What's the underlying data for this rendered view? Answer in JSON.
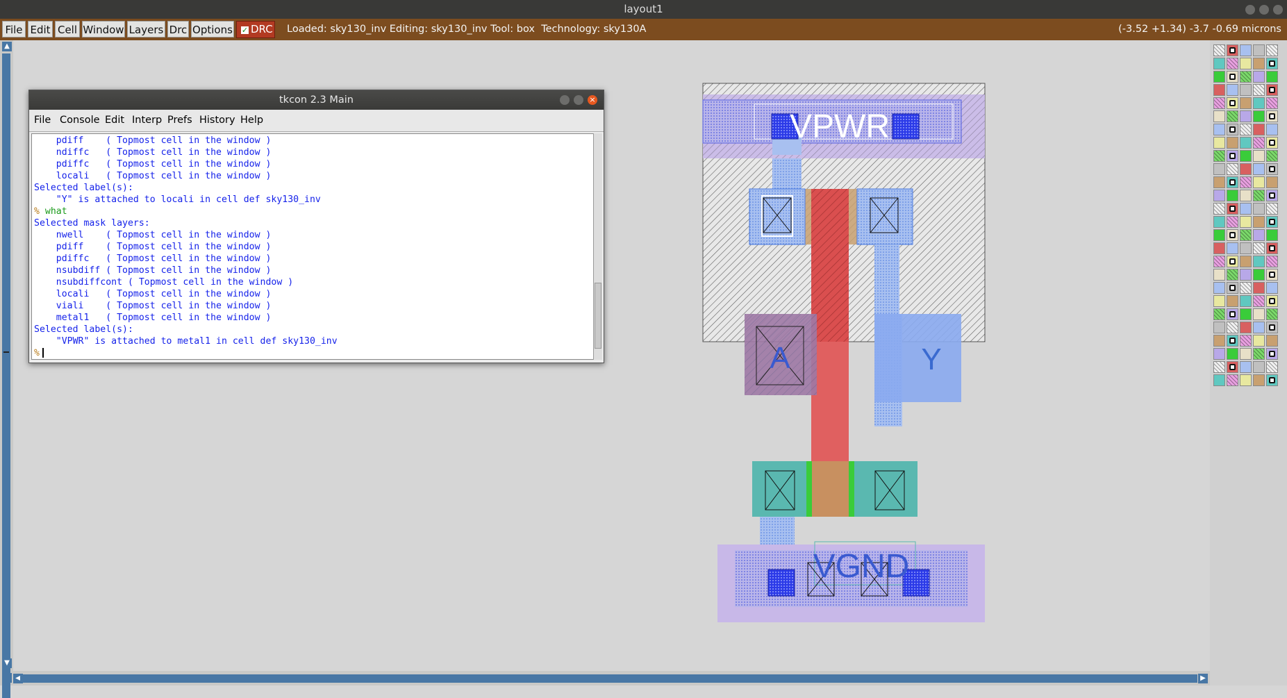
{
  "window": {
    "title": "layout1"
  },
  "menu": {
    "items": [
      "File",
      "Edit",
      "Cell",
      "Window",
      "Layers",
      "Drc",
      "Options"
    ],
    "drc_toggle": "DRC",
    "status": "Loaded: sky130_inv Editing: sky130_inv Tool: box  Technology: sky130A",
    "coords": "(-3.52 +1.34) -3.7 -0.69 microns"
  },
  "tkcon": {
    "title": "tkcon 2.3 Main",
    "menu": [
      "File",
      "Console",
      "Edit",
      "Interp",
      "Prefs",
      "History",
      "Help"
    ],
    "lines": [
      {
        "t": "    pdiff    ( Topmost cell in the window )",
        "c": "out"
      },
      {
        "t": "    ndiffc   ( Topmost cell in the window )",
        "c": "out"
      },
      {
        "t": "    pdiffc   ( Topmost cell in the window )",
        "c": "out"
      },
      {
        "t": "    locali   ( Topmost cell in the window )",
        "c": "out"
      },
      {
        "t": "Selected label(s):",
        "c": "out"
      },
      {
        "t": "    \"Y\" is attached to locali in cell def sky130_inv",
        "c": "out"
      },
      {
        "t": "what",
        "c": "cmd"
      },
      {
        "t": "Selected mask layers:",
        "c": "out"
      },
      {
        "t": "    nwell    ( Topmost cell in the window )",
        "c": "out"
      },
      {
        "t": "    pdiff    ( Topmost cell in the window )",
        "c": "out"
      },
      {
        "t": "    pdiffc   ( Topmost cell in the window )",
        "c": "out"
      },
      {
        "t": "    nsubdiff ( Topmost cell in the window )",
        "c": "out"
      },
      {
        "t": "    nsubdiffcont ( Topmost cell in the window )",
        "c": "out"
      },
      {
        "t": "    locali   ( Topmost cell in the window )",
        "c": "out"
      },
      {
        "t": "    viali    ( Topmost cell in the window )",
        "c": "out"
      },
      {
        "t": "    metal1   ( Topmost cell in the window )",
        "c": "out"
      },
      {
        "t": "Selected label(s):",
        "c": "out"
      },
      {
        "t": "    \"VPWR\" is attached to metal1 in cell def sky130_inv",
        "c": "out"
      },
      {
        "t": "",
        "c": "prompt"
      }
    ],
    "prompt": "%"
  },
  "layout_labels": {
    "vpwr": "VPWR",
    "vgnd": "VGND",
    "a": "A",
    "y": "Y"
  },
  "colors": {
    "menubar": "#7c4c1f",
    "scroll": "#4877a5",
    "poly": "#e06060",
    "locali": "#8aa8e8",
    "metal1": "#b8a8e0",
    "ndiff": "#5ab8b0"
  }
}
